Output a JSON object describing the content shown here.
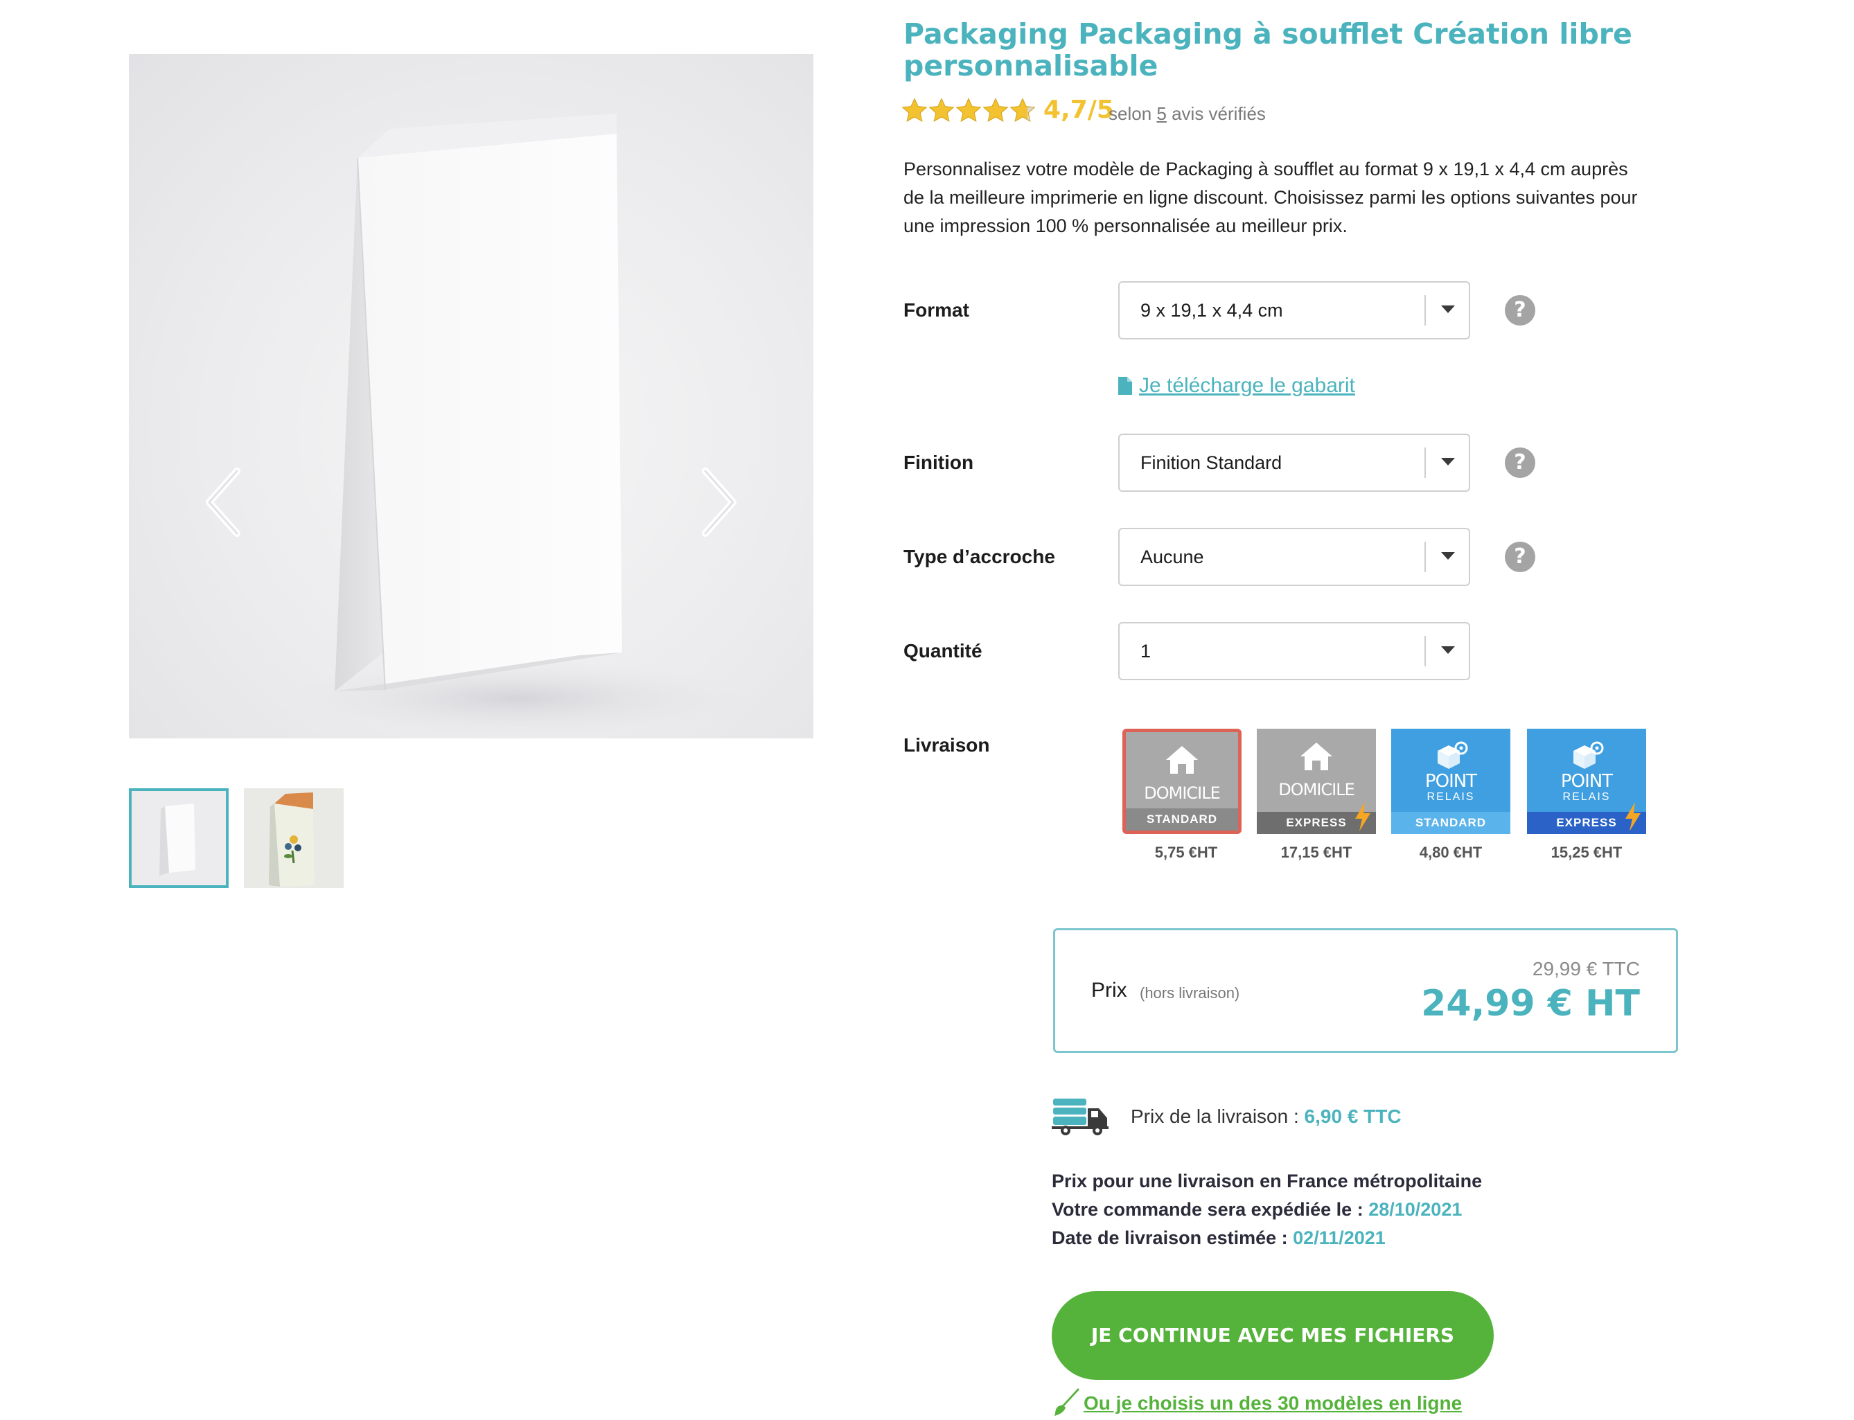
{
  "product": {
    "title": "Packaging Packaging à soufflet Création libre personnalisable",
    "rating": {
      "score": "4,7/5",
      "stars_value": 4.7,
      "stars_max": 5,
      "prefix": "selon",
      "count": "5",
      "suffix": "avis vérifiés"
    },
    "description": "Personnalisez votre modèle de Packaging à soufflet au format 9 x 19,1 x 4,4 cm auprès de la meilleure imprimerie en ligne discount. Choisissez parmi les options suivantes pour une impression 100 % personnalisée au meilleur prix."
  },
  "gallery": {
    "thumbnail_count": 2,
    "active_index": 0
  },
  "options": {
    "format": {
      "label": "Format",
      "value": "9 x 19,1 x 4,4 cm"
    },
    "template_link": "Je télécharge le gabarit",
    "finition": {
      "label": "Finition",
      "value": "Finition Standard"
    },
    "accroche": {
      "label": "Type d’accroche",
      "value": "Aucune"
    },
    "quantite": {
      "label": "Quantité",
      "value": "1"
    },
    "livraison": {
      "label": "Livraison",
      "choices": [
        {
          "name": "DOMICILE",
          "sub": "",
          "band": "STANDARD",
          "price": "5,75 €HT",
          "selected": true
        },
        {
          "name": "DOMICILE",
          "sub": "",
          "band": "EXPRESS",
          "price": "17,15 €HT",
          "selected": false
        },
        {
          "name": "POINT",
          "sub": "RELAIS",
          "band": "STANDARD",
          "price": "4,80 €HT",
          "selected": false
        },
        {
          "name": "POINT",
          "sub": "RELAIS",
          "band": "EXPRESS",
          "price": "15,25 €HT",
          "selected": false
        }
      ]
    }
  },
  "price": {
    "label": "Prix",
    "note": "(hors livraison)",
    "ttc": "29,99 € TTC",
    "ht": "24,99 € HT"
  },
  "delivery": {
    "cost_label": "Prix de la livraison :",
    "cost_value": "6,90 € TTC",
    "region": "Prix pour une livraison en France métropolitaine",
    "ship_label": "Votre commande sera expédiée le :",
    "ship_date": "28/10/2021",
    "eta_label": "Date de livraison estimée :",
    "eta_date": "02/11/2021"
  },
  "cta": {
    "continue": "JE CONTINUE AVEC MES FICHIERS",
    "templates": "Ou je choisis un des 30 modèles en ligne"
  },
  "colors": {
    "accent": "#4bb3bd",
    "rating": "#f2c230",
    "cta_green": "#55b33b",
    "selected_border": "#dc6356"
  }
}
